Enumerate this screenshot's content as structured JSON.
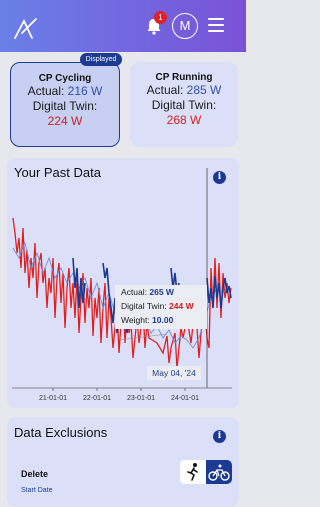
{
  "header": {
    "logo": "app-logo",
    "notification_count": "1",
    "avatar_initial": "M",
    "menu_icon": "hamburger-menu-icon"
  },
  "cards": {
    "cycling": {
      "title": "CP Cycling",
      "actual_label": "Actual:",
      "actual_value": "216 W",
      "twin_label": "Digital Twin:",
      "twin_value": "224 W",
      "displayed_badge": "Displayed"
    },
    "running": {
      "title": "CP Running",
      "actual_label": "Actual:",
      "actual_value": "285 W",
      "twin_label": "Digital Twin:",
      "twin_value": "268 W"
    }
  },
  "past_data": {
    "title": "Your Past Data",
    "tooltip": {
      "actual_label": "Actual:",
      "actual_value": "265 W",
      "twin_label": "Digital Twin:",
      "twin_value": "244 W",
      "weight_label": "Weight:",
      "weight_value": "10.00"
    },
    "date_tooltip": "May 04, '24"
  },
  "chart_data": {
    "type": "line",
    "x_tick_labels": [
      "21-01-01",
      "22-01-01",
      "23-01-01",
      "24-01-01"
    ],
    "series": [
      {
        "color": "#1d3a92"
      },
      {
        "color": "#e02020"
      },
      {
        "color": "#6f8fd8"
      }
    ],
    "grid": false,
    "cursor_date": "May 04, '24"
  },
  "exclusions": {
    "title": "Data Exclusions",
    "delete_label": "Delete",
    "start_date_label": "Start Date",
    "toggle_left_icon": "running-icon",
    "toggle_right_icon": "cycling-icon"
  },
  "colors": {
    "header_start": "#6a7fe8",
    "header_end": "#7a52d6",
    "accent": "#1d3a92",
    "twin_red": "#d42020"
  }
}
